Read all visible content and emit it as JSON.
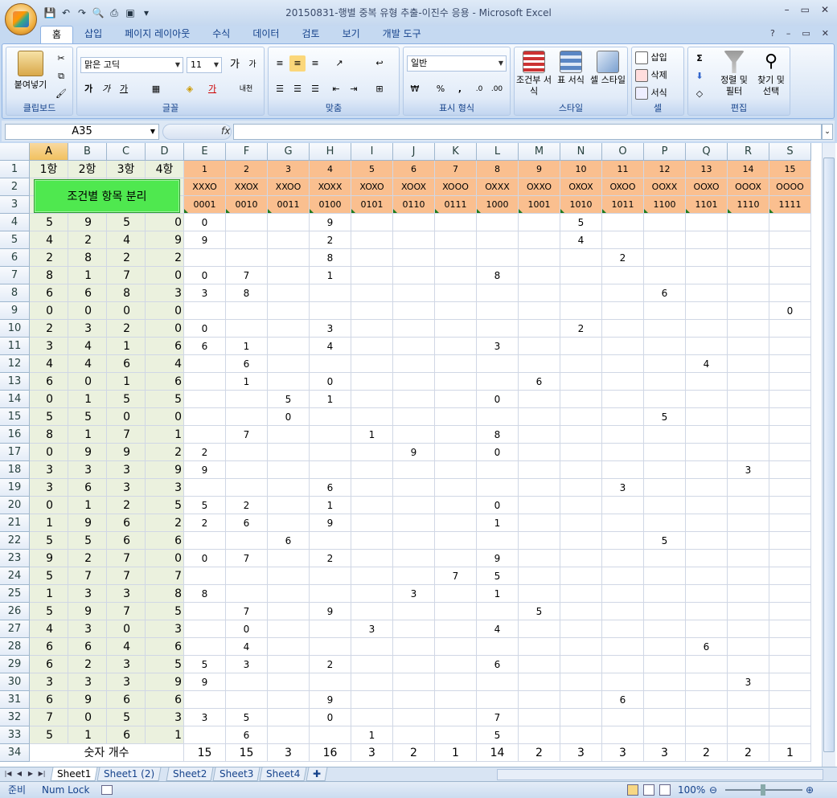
{
  "window": {
    "title": "20150831-행별 중복 유형 추출-이진수 응용 - Microsoft Excel",
    "controls": [
      "–",
      "▭",
      "✕"
    ],
    "doc_controls": [
      "?",
      "–",
      "▭",
      "✕"
    ]
  },
  "tabs": [
    "홈",
    "삽입",
    "페이지 레이아웃",
    "수식",
    "데이터",
    "검토",
    "보기",
    "개발 도구"
  ],
  "ribbon": {
    "clipboard": {
      "label": "클립보드",
      "paste": "붙여넣기"
    },
    "font": {
      "label": "글꼴",
      "name": "맑은 고딕",
      "size": "11",
      "bold": "가",
      "italic": "가",
      "underline": "가",
      "grow": "가",
      "shrink": "가",
      "phonetic": "내천"
    },
    "alignment": {
      "label": "맞춤"
    },
    "number": {
      "label": "표시 형식",
      "format": "일반",
      "currency": "₩",
      "percent": "%",
      "comma": ","
    },
    "styles": {
      "label": "스타일",
      "conditional": "조건부 서식",
      "table": "표 서식",
      "cell": "셀 스타일"
    },
    "cells": {
      "label": "셀",
      "insert": "삽입",
      "delete": "삭제",
      "format": "서식"
    },
    "editing": {
      "label": "편집",
      "sort": "정렬 및 필터",
      "find": "찾기 및 선택"
    }
  },
  "formula_bar": {
    "name_box": "A35",
    "fx": "fx",
    "value": ""
  },
  "columns": [
    "A",
    "B",
    "C",
    "D",
    "E",
    "F",
    "G",
    "H",
    "I",
    "J",
    "K",
    "L",
    "M",
    "N",
    "O",
    "P",
    "Q",
    "R",
    "S"
  ],
  "header_row1": {
    "A": "1항",
    "B": "2항",
    "C": "3항",
    "D": "4항",
    "E": "1",
    "F": "2",
    "G": "3",
    "H": "4",
    "I": "5",
    "J": "6",
    "K": "7",
    "L": "8",
    "M": "9",
    "N": "10",
    "O": "11",
    "P": "12",
    "Q": "13",
    "R": "14",
    "S": "15"
  },
  "patterns": [
    "XXXO",
    "XXOX",
    "XXOO",
    "XOXX",
    "XOXO",
    "XOOX",
    "XOOO",
    "OXXX",
    "OXXO",
    "OXOX",
    "OXOO",
    "OOXX",
    "OOXO",
    "OOOX",
    "OOOO"
  ],
  "binaries": [
    "0001",
    "0010",
    "0011",
    "0100",
    "0101",
    "0110",
    "0111",
    "1000",
    "1001",
    "1010",
    "1011",
    "1100",
    "1101",
    "1110",
    "1111"
  ],
  "button_label": "조건별 항목 분리",
  "rows": [
    {
      "n": 4,
      "A": "5",
      "B": "9",
      "C": "5",
      "D": "0",
      "E": "0",
      "H": "9",
      "N": "5"
    },
    {
      "n": 5,
      "A": "4",
      "B": "2",
      "C": "4",
      "D": "9",
      "E": "9",
      "H": "2",
      "N": "4"
    },
    {
      "n": 6,
      "A": "2",
      "B": "8",
      "C": "2",
      "D": "2",
      "H": "8",
      "O": "2"
    },
    {
      "n": 7,
      "A": "8",
      "B": "1",
      "C": "7",
      "D": "0",
      "E": "0",
      "F": "7",
      "H": "1",
      "L": "8"
    },
    {
      "n": 8,
      "A": "6",
      "B": "6",
      "C": "8",
      "D": "3",
      "E": "3",
      "F": "8",
      "P": "6"
    },
    {
      "n": 9,
      "A": "0",
      "B": "0",
      "C": "0",
      "D": "0",
      "S": "0"
    },
    {
      "n": 10,
      "A": "2",
      "B": "3",
      "C": "2",
      "D": "0",
      "E": "0",
      "H": "3",
      "N": "2"
    },
    {
      "n": 11,
      "A": "3",
      "B": "4",
      "C": "1",
      "D": "6",
      "E": "6",
      "F": "1",
      "H": "4",
      "L": "3"
    },
    {
      "n": 12,
      "A": "4",
      "B": "4",
      "C": "6",
      "D": "4",
      "F": "6",
      "Q": "4"
    },
    {
      "n": 13,
      "A": "6",
      "B": "0",
      "C": "1",
      "D": "6",
      "F": "1",
      "H": "0",
      "M": "6"
    },
    {
      "n": 14,
      "A": "0",
      "B": "1",
      "C": "5",
      "D": "5",
      "G": "5",
      "H": "1",
      "L": "0"
    },
    {
      "n": 15,
      "A": "5",
      "B": "5",
      "C": "0",
      "D": "0",
      "G": "0",
      "P": "5"
    },
    {
      "n": 16,
      "A": "8",
      "B": "1",
      "C": "7",
      "D": "1",
      "F": "7",
      "I": "1",
      "L": "8"
    },
    {
      "n": 17,
      "A": "0",
      "B": "9",
      "C": "9",
      "D": "2",
      "E": "2",
      "J": "9",
      "L": "0"
    },
    {
      "n": 18,
      "A": "3",
      "B": "3",
      "C": "3",
      "D": "9",
      "E": "9",
      "R": "3"
    },
    {
      "n": 19,
      "A": "3",
      "B": "6",
      "C": "3",
      "D": "3",
      "H": "6",
      "O": "3"
    },
    {
      "n": 20,
      "A": "0",
      "B": "1",
      "C": "2",
      "D": "5",
      "E": "5",
      "F": "2",
      "H": "1",
      "L": "0"
    },
    {
      "n": 21,
      "A": "1",
      "B": "9",
      "C": "6",
      "D": "2",
      "E": "2",
      "F": "6",
      "H": "9",
      "L": "1"
    },
    {
      "n": 22,
      "A": "5",
      "B": "5",
      "C": "6",
      "D": "6",
      "G": "6",
      "P": "5"
    },
    {
      "n": 23,
      "A": "9",
      "B": "2",
      "C": "7",
      "D": "0",
      "E": "0",
      "F": "7",
      "H": "2",
      "L": "9"
    },
    {
      "n": 24,
      "A": "5",
      "B": "7",
      "C": "7",
      "D": "7",
      "K": "7",
      "L": "5"
    },
    {
      "n": 25,
      "A": "1",
      "B": "3",
      "C": "3",
      "D": "8",
      "E": "8",
      "J": "3",
      "L": "1"
    },
    {
      "n": 26,
      "A": "5",
      "B": "9",
      "C": "7",
      "D": "5",
      "F": "7",
      "H": "9",
      "M": "5"
    },
    {
      "n": 27,
      "A": "4",
      "B": "3",
      "C": "0",
      "D": "3",
      "F": "0",
      "I": "3",
      "L": "4"
    },
    {
      "n": 28,
      "A": "6",
      "B": "6",
      "C": "4",
      "D": "6",
      "F": "4",
      "Q": "6"
    },
    {
      "n": 29,
      "A": "6",
      "B": "2",
      "C": "3",
      "D": "5",
      "E": "5",
      "F": "3",
      "H": "2",
      "L": "6"
    },
    {
      "n": 30,
      "A": "3",
      "B": "3",
      "C": "3",
      "D": "9",
      "E": "9",
      "R": "3"
    },
    {
      "n": 31,
      "A": "6",
      "B": "9",
      "C": "6",
      "D": "6",
      "H": "9",
      "O": "6"
    },
    {
      "n": 32,
      "A": "7",
      "B": "0",
      "C": "5",
      "D": "3",
      "E": "3",
      "F": "5",
      "H": "0",
      "L": "7"
    },
    {
      "n": 33,
      "A": "5",
      "B": "1",
      "C": "6",
      "D": "1",
      "F": "6",
      "I": "1",
      "L": "5"
    }
  ],
  "count_row": {
    "label": "숫자 개수",
    "E": "15",
    "F": "15",
    "G": "3",
    "H": "16",
    "I": "3",
    "J": "2",
    "K": "1",
    "L": "14",
    "M": "2",
    "N": "3",
    "O": "3",
    "P": "3",
    "Q": "2",
    "R": "2",
    "S": "1"
  },
  "sheets": [
    "Sheet1",
    "Sheet1 (2)",
    "Sheet2",
    "Sheet3",
    "Sheet4"
  ],
  "active_sheet": 0,
  "status": {
    "ready": "준비",
    "numlock": "Num Lock",
    "zoom": "100%"
  }
}
